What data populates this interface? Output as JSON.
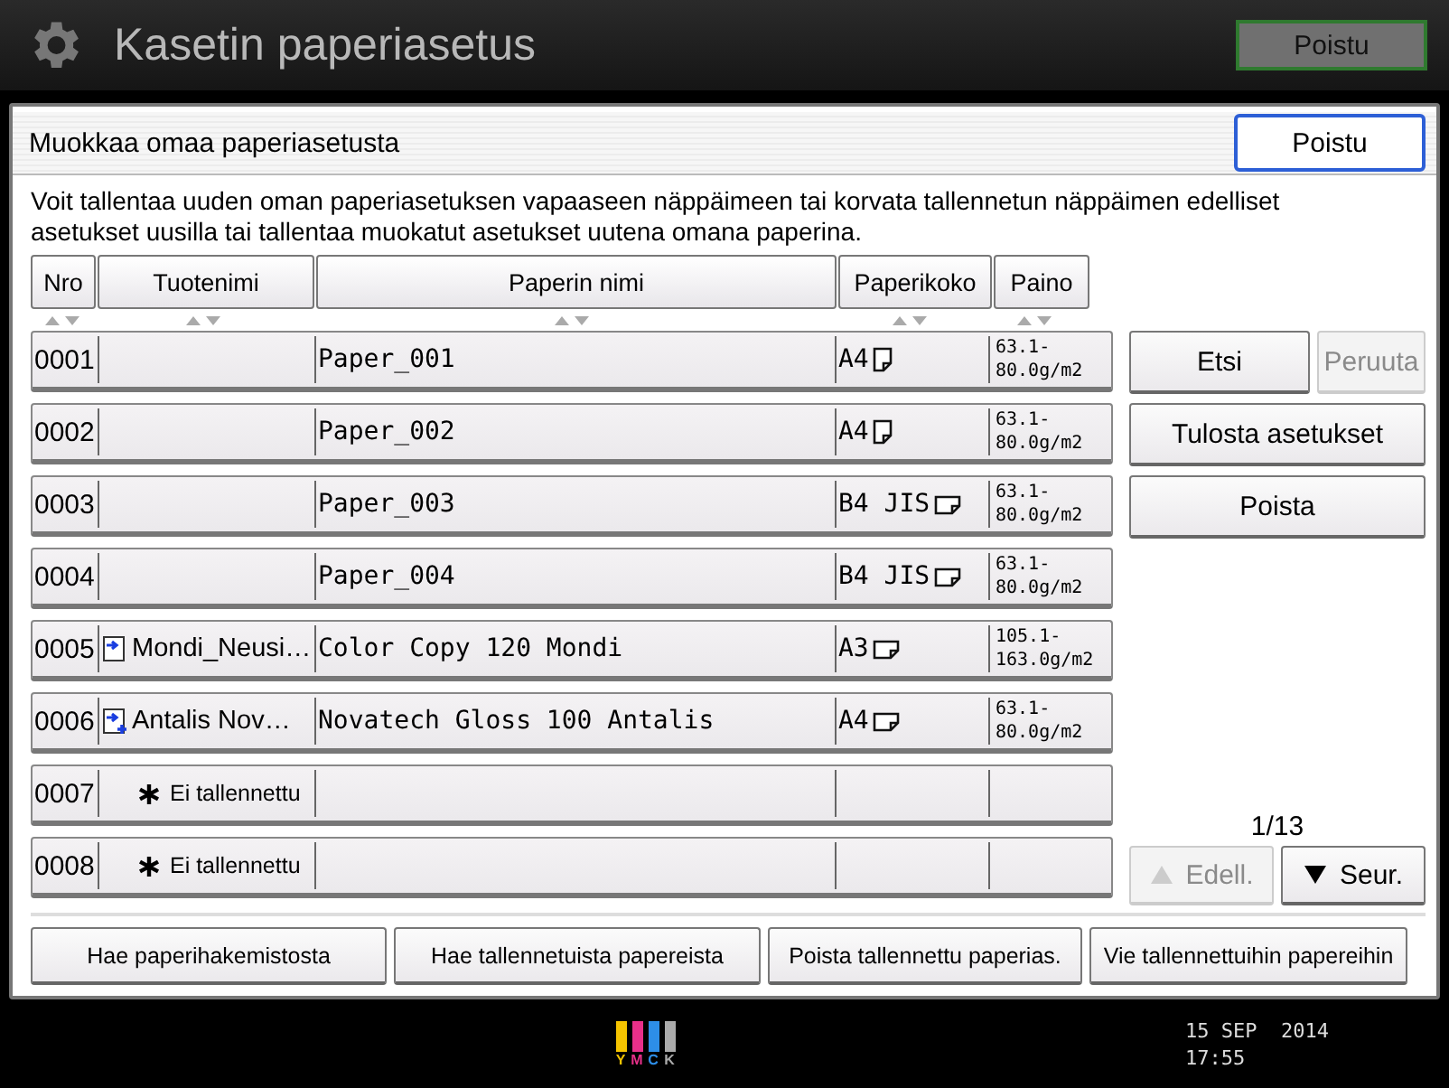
{
  "header": {
    "title": "Kasetin paperiasetus",
    "exit_button": "Poistu"
  },
  "dialog": {
    "title": "Muokkaa omaa paperiasetusta",
    "exit_button": "Poistu",
    "description": "Voit tallentaa uuden oman paperiasetuksen vapaaseen näppäimeen tai korvata tallennetun näppäimen edelliset asetukset uusilla tai tallentaa muokatut asetukset uutena omana paperina."
  },
  "table": {
    "columns": [
      "Nro",
      "Tuotenimi",
      "Paperin nimi",
      "Paperikoko",
      "Paino"
    ],
    "rows": [
      {
        "kind": "local",
        "number": "0001",
        "paper_name": "Paper_001",
        "size": {
          "label": "A4",
          "kind": "portrait"
        },
        "weight": [
          "63.1-",
          "80.0g/m2"
        ]
      },
      {
        "kind": "local",
        "number": "0002",
        "paper_name": "Paper_002",
        "size": {
          "label": "A4",
          "kind": "portrait"
        },
        "weight": [
          "63.1-",
          "80.0g/m2"
        ]
      },
      {
        "kind": "local",
        "number": "0003",
        "paper_name": "Paper_003",
        "size": {
          "label": "B4 JIS",
          "kind": "landscape"
        },
        "weight": [
          "63.1-",
          "80.0g/m2"
        ]
      },
      {
        "kind": "local",
        "number": "0004",
        "paper_name": "Paper_004",
        "size": {
          "label": "B4 JIS",
          "kind": "landscape"
        },
        "weight": [
          "63.1-",
          "80.0g/m2"
        ]
      },
      {
        "kind": "imported",
        "number": "0005",
        "product": "Mondi_Neusi…",
        "paper_name": "Color Copy 120 Mondi",
        "size": {
          "label": "A3",
          "kind": "landscape"
        },
        "weight": [
          "105.1-",
          "163.0g/m2"
        ]
      },
      {
        "kind": "imported-new",
        "number": "0006",
        "product": "Antalis Nov…",
        "paper_name": "Novatech Gloss 100 Antalis",
        "size": {
          "label": "A4",
          "kind": "landscape"
        },
        "weight": [
          "63.1-",
          "80.0g/m2"
        ]
      },
      {
        "kind": "empty",
        "number": "0007",
        "product": "Ei tallennettu"
      },
      {
        "kind": "empty",
        "number": "0008",
        "product": "Ei tallennettu"
      }
    ]
  },
  "side_buttons": [
    {
      "label": "Etsi",
      "disabled": false
    },
    {
      "label": "Peruuta",
      "disabled": true
    },
    {
      "label": "Tulosta asetukset",
      "disabled": false
    },
    {
      "label": "Poista",
      "disabled": false
    }
  ],
  "pager": {
    "page": "1/13",
    "prev": {
      "label": "Edell.",
      "disabled": true
    },
    "next": {
      "label": "Seur.",
      "disabled": false
    }
  },
  "bottom_buttons": [
    "Hae paperihakemistosta",
    "Hae tallennetuista papereista",
    "Poista tallennettu paperias.",
    "Vie tallennettuihin papereihin"
  ],
  "status_bar": {
    "toner_labels": [
      "Y",
      "M",
      "C",
      "K"
    ],
    "date": "15 SEP  2014",
    "time": "17:55"
  }
}
